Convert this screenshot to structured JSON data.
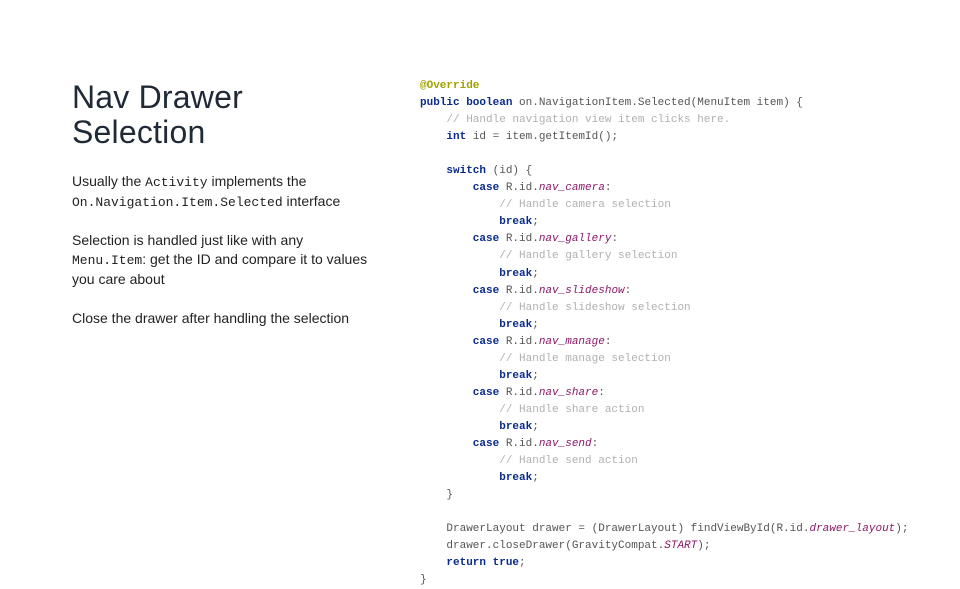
{
  "title": "Nav Drawer Selection",
  "p1": {
    "t1": "Usually the ",
    "c1": "Activity",
    "t2": " implements the ",
    "c2": "On.Navigation.Item.Selected",
    "t3": " interface"
  },
  "p2": {
    "t1": "Selection is handled just like with any ",
    "c1": "Menu.Item",
    "t2": ": get the ID and compare it to values you care about"
  },
  "p3": "Close the drawer after handling the selection",
  "code": {
    "l01a": "@Override",
    "l02a": "public",
    "l02b": " boolean",
    "l02c": " on.NavigationItem.Selected(MenuItem item) {",
    "l03": "    // Handle navigation view item clicks here.",
    "l04a": "    int",
    "l04b": " id = item.getItemId();",
    "blank1": "",
    "l05a": "    switch",
    "l05b": " (id) {",
    "l06a": "        case",
    "l06b": " R.id.",
    "l06c": "nav_camera",
    "l06d": ":",
    "l07": "            // Handle camera selection",
    "l08a": "            break",
    "l08b": ";",
    "l09a": "        case",
    "l09b": " R.id.",
    "l09c": "nav_gallery",
    "l09d": ":",
    "l10": "            // Handle gallery selection",
    "l11a": "            break",
    "l11b": ";",
    "l12a": "        case",
    "l12b": " R.id.",
    "l12c": "nav_slideshow",
    "l12d": ":",
    "l13": "            // Handle slideshow selection",
    "l14a": "            break",
    "l14b": ";",
    "l15a": "        case",
    "l15b": " R.id.",
    "l15c": "nav_manage",
    "l15d": ":",
    "l16": "            // Handle manage selection",
    "l17a": "            break",
    "l17b": ";",
    "l18a": "        case",
    "l18b": " R.id.",
    "l18c": "nav_share",
    "l18d": ":",
    "l19": "            // Handle share action",
    "l20a": "            break",
    "l20b": ";",
    "l21a": "        case",
    "l21b": " R.id.",
    "l21c": "nav_send",
    "l21d": ":",
    "l22": "            // Handle send action",
    "l23a": "            break",
    "l23b": ";",
    "l24": "    }",
    "blank2": "",
    "l25a": "    DrawerLayout drawer = (DrawerLayout) findViewById(R.id.",
    "l25b": "drawer_layout",
    "l25c": ");",
    "l26a": "    drawer.closeDrawer(GravityCompat.",
    "l26b": "START",
    "l26c": ");",
    "l27a": "    return true",
    "l27b": ";",
    "l28": "}"
  }
}
